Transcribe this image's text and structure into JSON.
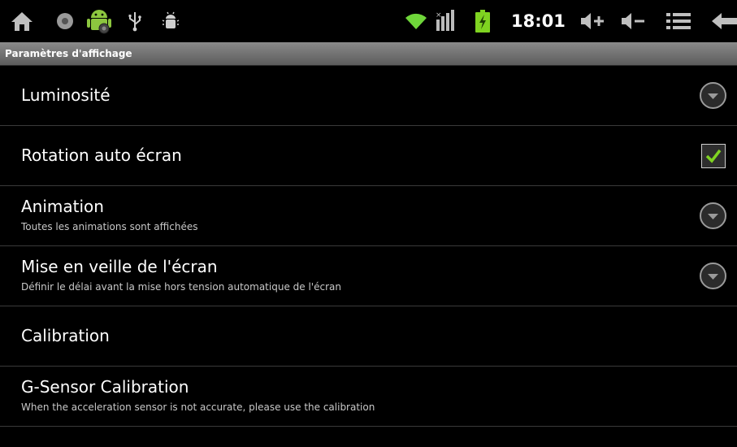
{
  "status_bar": {
    "time": "18:01",
    "icons": [
      "home-icon",
      "camera-icon",
      "android-icon",
      "usb-icon",
      "debug-icon",
      "wifi-icon",
      "signal-icon",
      "battery-charging-icon",
      "volume-up-icon",
      "volume-down-icon",
      "menu-icon",
      "back-icon"
    ]
  },
  "title_bar": {
    "title": "Paramètres d'affichage"
  },
  "settings": [
    {
      "title": "Luminosité",
      "summary": "",
      "widget": "dropdown"
    },
    {
      "title": "Rotation auto écran",
      "summary": "",
      "widget": "checkbox",
      "checked": true
    },
    {
      "title": "Animation",
      "summary": "Toutes les animations sont affichées",
      "widget": "dropdown"
    },
    {
      "title": "Mise en veille de l'écran",
      "summary": "Définir le délai avant la mise hors tension automatique de l'écran",
      "widget": "dropdown"
    },
    {
      "title": "Calibration",
      "summary": "",
      "widget": "none"
    },
    {
      "title": "G-Sensor Calibration",
      "summary": "When the acceleration sensor is not accurate, please use the calibration",
      "widget": "none"
    }
  ],
  "colors": {
    "accent_green": "#7fd321",
    "wifi_green": "#6fd63a"
  }
}
